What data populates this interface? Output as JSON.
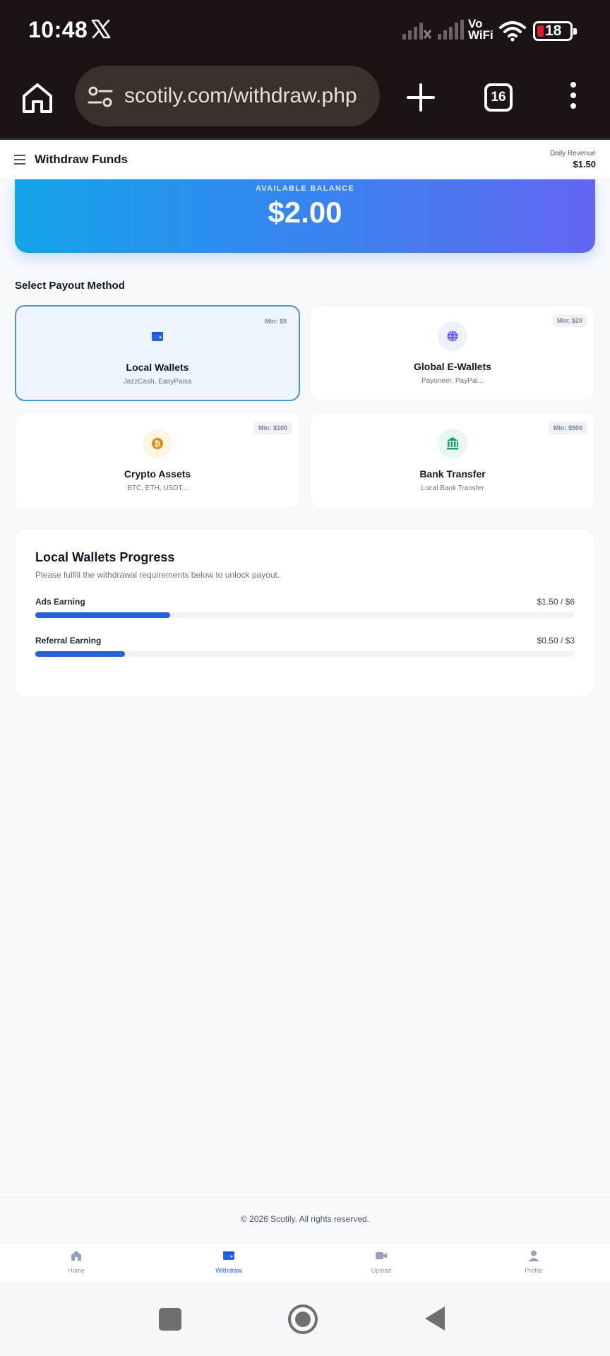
{
  "status_bar": {
    "time": "10:48",
    "vo": "Vo",
    "wifi_label": "WiFi",
    "battery": "18",
    "icons": [
      "x-logo-icon",
      "signal-no-service-icon",
      "signal-icon",
      "vowifi-icon",
      "wifi-icon",
      "battery-icon"
    ]
  },
  "browser": {
    "url": "scotily.com/withdraw.php",
    "tab_count": "16",
    "icons": [
      "home-icon",
      "site-settings-icon",
      "new-tab-plus-icon",
      "tab-switcher-icon",
      "more-vert-icon"
    ]
  },
  "header": {
    "title": "Withdraw Funds",
    "daily_revenue_label": "Daily Revenue",
    "daily_revenue_value": "$1.50"
  },
  "balance": {
    "label": "AVAILABLE BALANCE",
    "amount": "$2.00"
  },
  "payout": {
    "section_title": "Select Payout Method",
    "methods": [
      {
        "name": "Local Wallets",
        "sub": "JazzCash, EasyPaisa",
        "min": "Min: $9",
        "icon": "wallet-icon",
        "selected": true
      },
      {
        "name": "Global E-Wallets",
        "sub": "Payoneer, PayPal...",
        "min": "Min: $20",
        "icon": "globe-icon",
        "selected": false
      },
      {
        "name": "Crypto Assets",
        "sub": "BTC, ETH, USDT...",
        "min": "Min: $100",
        "icon": "bitcoin-icon",
        "selected": false
      },
      {
        "name": "Bank Transfer",
        "sub": "Local Bank Transfer",
        "min": "Min: $500",
        "icon": "bank-icon",
        "selected": false
      }
    ]
  },
  "progress": {
    "title": "Local Wallets Progress",
    "description": "Please fulfill the withdrawal requirements below to unlock payout.",
    "items": [
      {
        "label": "Ads Earning",
        "value_text": "$1.50 / $6",
        "fraction": 0.25
      },
      {
        "label": "Referral Earning",
        "value_text": "$0.50 / $3",
        "fraction": 0.1667
      }
    ]
  },
  "footer": {
    "copyright": "© 2026 Scotily. All rights reserved."
  },
  "bottom_nav": {
    "items": [
      {
        "label": "Home",
        "icon": "home-icon",
        "active": false
      },
      {
        "label": "Withdraw",
        "icon": "wallet-icon",
        "active": true
      },
      {
        "label": "Upload",
        "icon": "video-camera-icon",
        "active": false
      },
      {
        "label": "Profile",
        "icon": "user-icon",
        "active": false
      }
    ]
  },
  "colors": {
    "accent": "#2563eb",
    "progress_bar": "#2563d9",
    "balance_gradient_start": "#13a3e9",
    "balance_gradient_end": "#6366f1",
    "browser_chrome": "#1c1414"
  }
}
